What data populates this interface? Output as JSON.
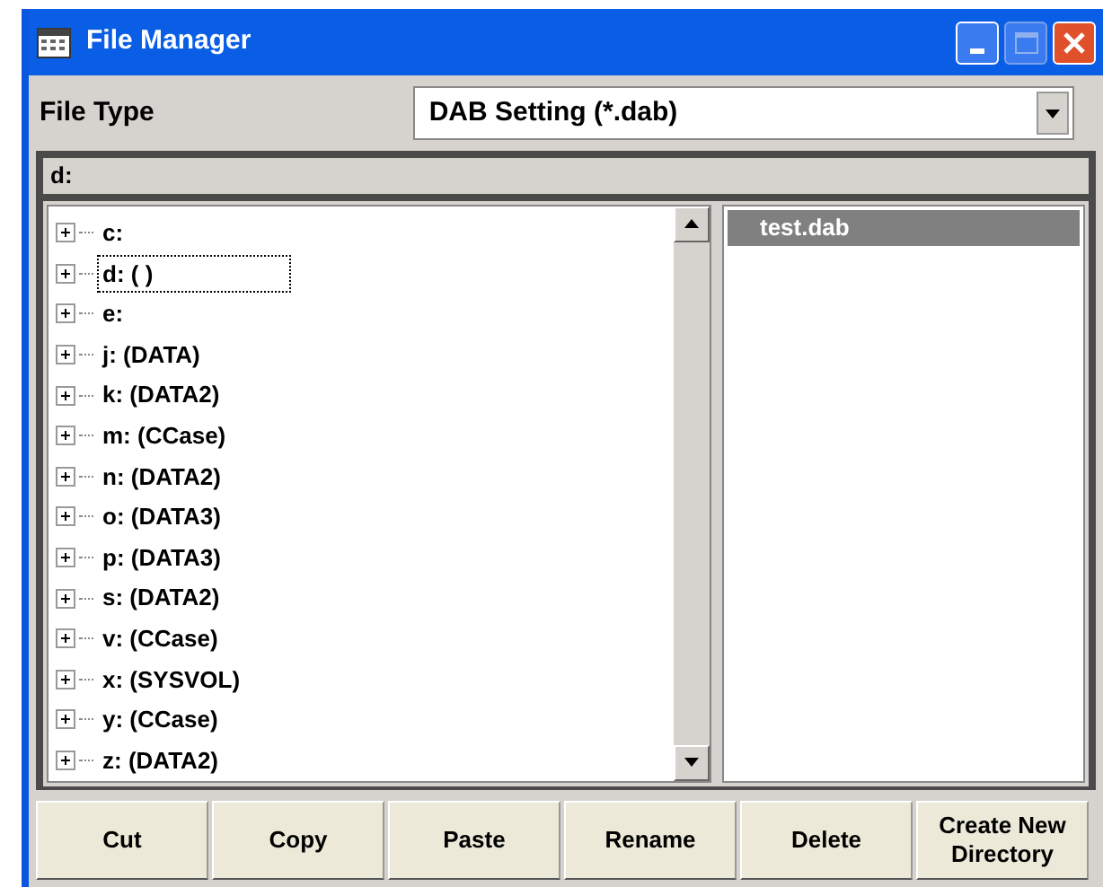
{
  "window": {
    "title": "File Manager"
  },
  "file_type": {
    "label": "File Type",
    "value": "DAB Setting (*.dab)"
  },
  "path": "d:",
  "tree": {
    "items": [
      {
        "label": "c:",
        "selected": false
      },
      {
        "label": "d: ( )",
        "selected": true
      },
      {
        "label": "e:",
        "selected": false
      },
      {
        "label": "j: (DATA)",
        "selected": false
      },
      {
        "label": "k: (DATA2)",
        "selected": false
      },
      {
        "label": "m: (CCase)",
        "selected": false
      },
      {
        "label": "n: (DATA2)",
        "selected": false
      },
      {
        "label": "o: (DATA3)",
        "selected": false
      },
      {
        "label": "p: (DATA3)",
        "selected": false
      },
      {
        "label": "s: (DATA2)",
        "selected": false
      },
      {
        "label": "v: (CCase)",
        "selected": false
      },
      {
        "label": "x: (SYSVOL)",
        "selected": false
      },
      {
        "label": "y: (CCase)",
        "selected": false
      },
      {
        "label": "z: (DATA2)",
        "selected": false
      }
    ]
  },
  "files": [
    {
      "label": "test.dab",
      "selected": true
    }
  ],
  "buttons": [
    "Cut",
    "Copy",
    "Paste",
    "Rename",
    "Delete",
    "Create New Directory"
  ]
}
